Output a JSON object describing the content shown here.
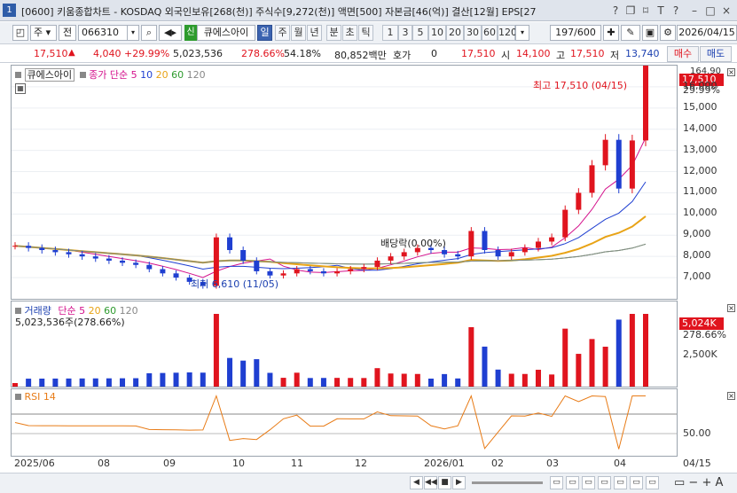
{
  "window": {
    "number": "1",
    "title": "[0600] 키움종합차트 - KOSDAQ 외국인보유[268(천)] 주식수[9,272(천)] 액면[500] 자본금[46(억)] 결산[12월] EPS[27",
    "controls": [
      "?",
      "T",
      "?",
      "-",
      "□",
      "×"
    ]
  },
  "toolbar": {
    "period_type": "주",
    "view_label": "전",
    "stock_code": "066310",
    "credit_badge": "신",
    "stock_name": "큐에스아이",
    "period_tabs": [
      "일",
      "주",
      "월",
      "년",
      "분",
      "초",
      "틱"
    ],
    "active_tab": "일",
    "intervals": [
      "1",
      "3",
      "5",
      "10",
      "20",
      "30",
      "60",
      "120"
    ],
    "count": "197/600",
    "date": "2026/04/15"
  },
  "quote": {
    "price": "17,510",
    "change": "4,040",
    "change_pct": "+29.99%",
    "volume": "5,023,536",
    "volume_ratio": "278.66%",
    "turnover": "54.18%",
    "amount": "80,852백만",
    "hoga_label": "호가",
    "hoga_value": "0",
    "bid_price": "17,510",
    "open_label": "시",
    "open": "14,100",
    "high_label": "고",
    "high": "17,510",
    "low_label": "저",
    "low": "13,740",
    "buy_button": "매수",
    "sell_button": "매도"
  },
  "price_pane": {
    "stock_label": "큐에스아이",
    "ma_title": "종가 단순",
    "ma_periods": [
      "5",
      "10",
      "20",
      "60",
      "120"
    ],
    "ma_colors": [
      "#d4118c",
      "#1f3fd1",
      "#e8a316",
      "#2e9b2e",
      "#888888"
    ],
    "y_labels": [
      "16,000",
      "15,000",
      "14,000",
      "13,000",
      "12,000",
      "11,000",
      "10,000",
      "9,000",
      "8,000",
      "7,000"
    ],
    "top_label": "164.90",
    "last_price_tag": "17,510",
    "last_pct_tag": "29.99%",
    "annotation_high": "최고 17,510 (04/15)",
    "annotation_low": "최저 6,610 (11/05)",
    "annotation_dividend": "배당락(0.00%)"
  },
  "volume_pane": {
    "title": "거래량",
    "ma_title": "단순",
    "ma_periods": [
      "5",
      "20",
      "60",
      "120"
    ],
    "ma_colors": [
      "#d4118c",
      "#e8a316",
      "#2e9b2e",
      "#888888"
    ],
    "current": "5,023,536주(278.66%)",
    "y_label": "2,500K",
    "last_tag": "5,024K",
    "last_pct_tag": "278.66%"
  },
  "rsi_pane": {
    "title": "RSI 14",
    "y_label": "50.00"
  },
  "x_axis": {
    "labels": [
      "2025/06",
      "08",
      "09",
      "10",
      "11",
      "12",
      "2026/01",
      "02",
      "03",
      "04"
    ],
    "last_label": "04/15"
  },
  "chart_data": {
    "type": "line",
    "title": "",
    "series": [
      {
        "name": "종가",
        "values": [
          8500,
          8400,
          8300,
          8200,
          8100,
          8000,
          7900,
          7800,
          7700,
          7600,
          7400,
          7200,
          7000,
          6800,
          6610,
          8900,
          8300,
          7800,
          7300,
          7100,
          7200,
          7400,
          7300,
          7200,
          7300,
          7400,
          7500,
          7800,
          8000,
          8200,
          8400,
          8300,
          8100,
          8000,
          9200,
          8300,
          8000,
          8200,
          8400,
          8700,
          8900,
          10200,
          11000,
          12300,
          13500,
          11200,
          13470,
          17510
        ]
      }
    ],
    "ylim": [
      6000,
      17500
    ]
  }
}
